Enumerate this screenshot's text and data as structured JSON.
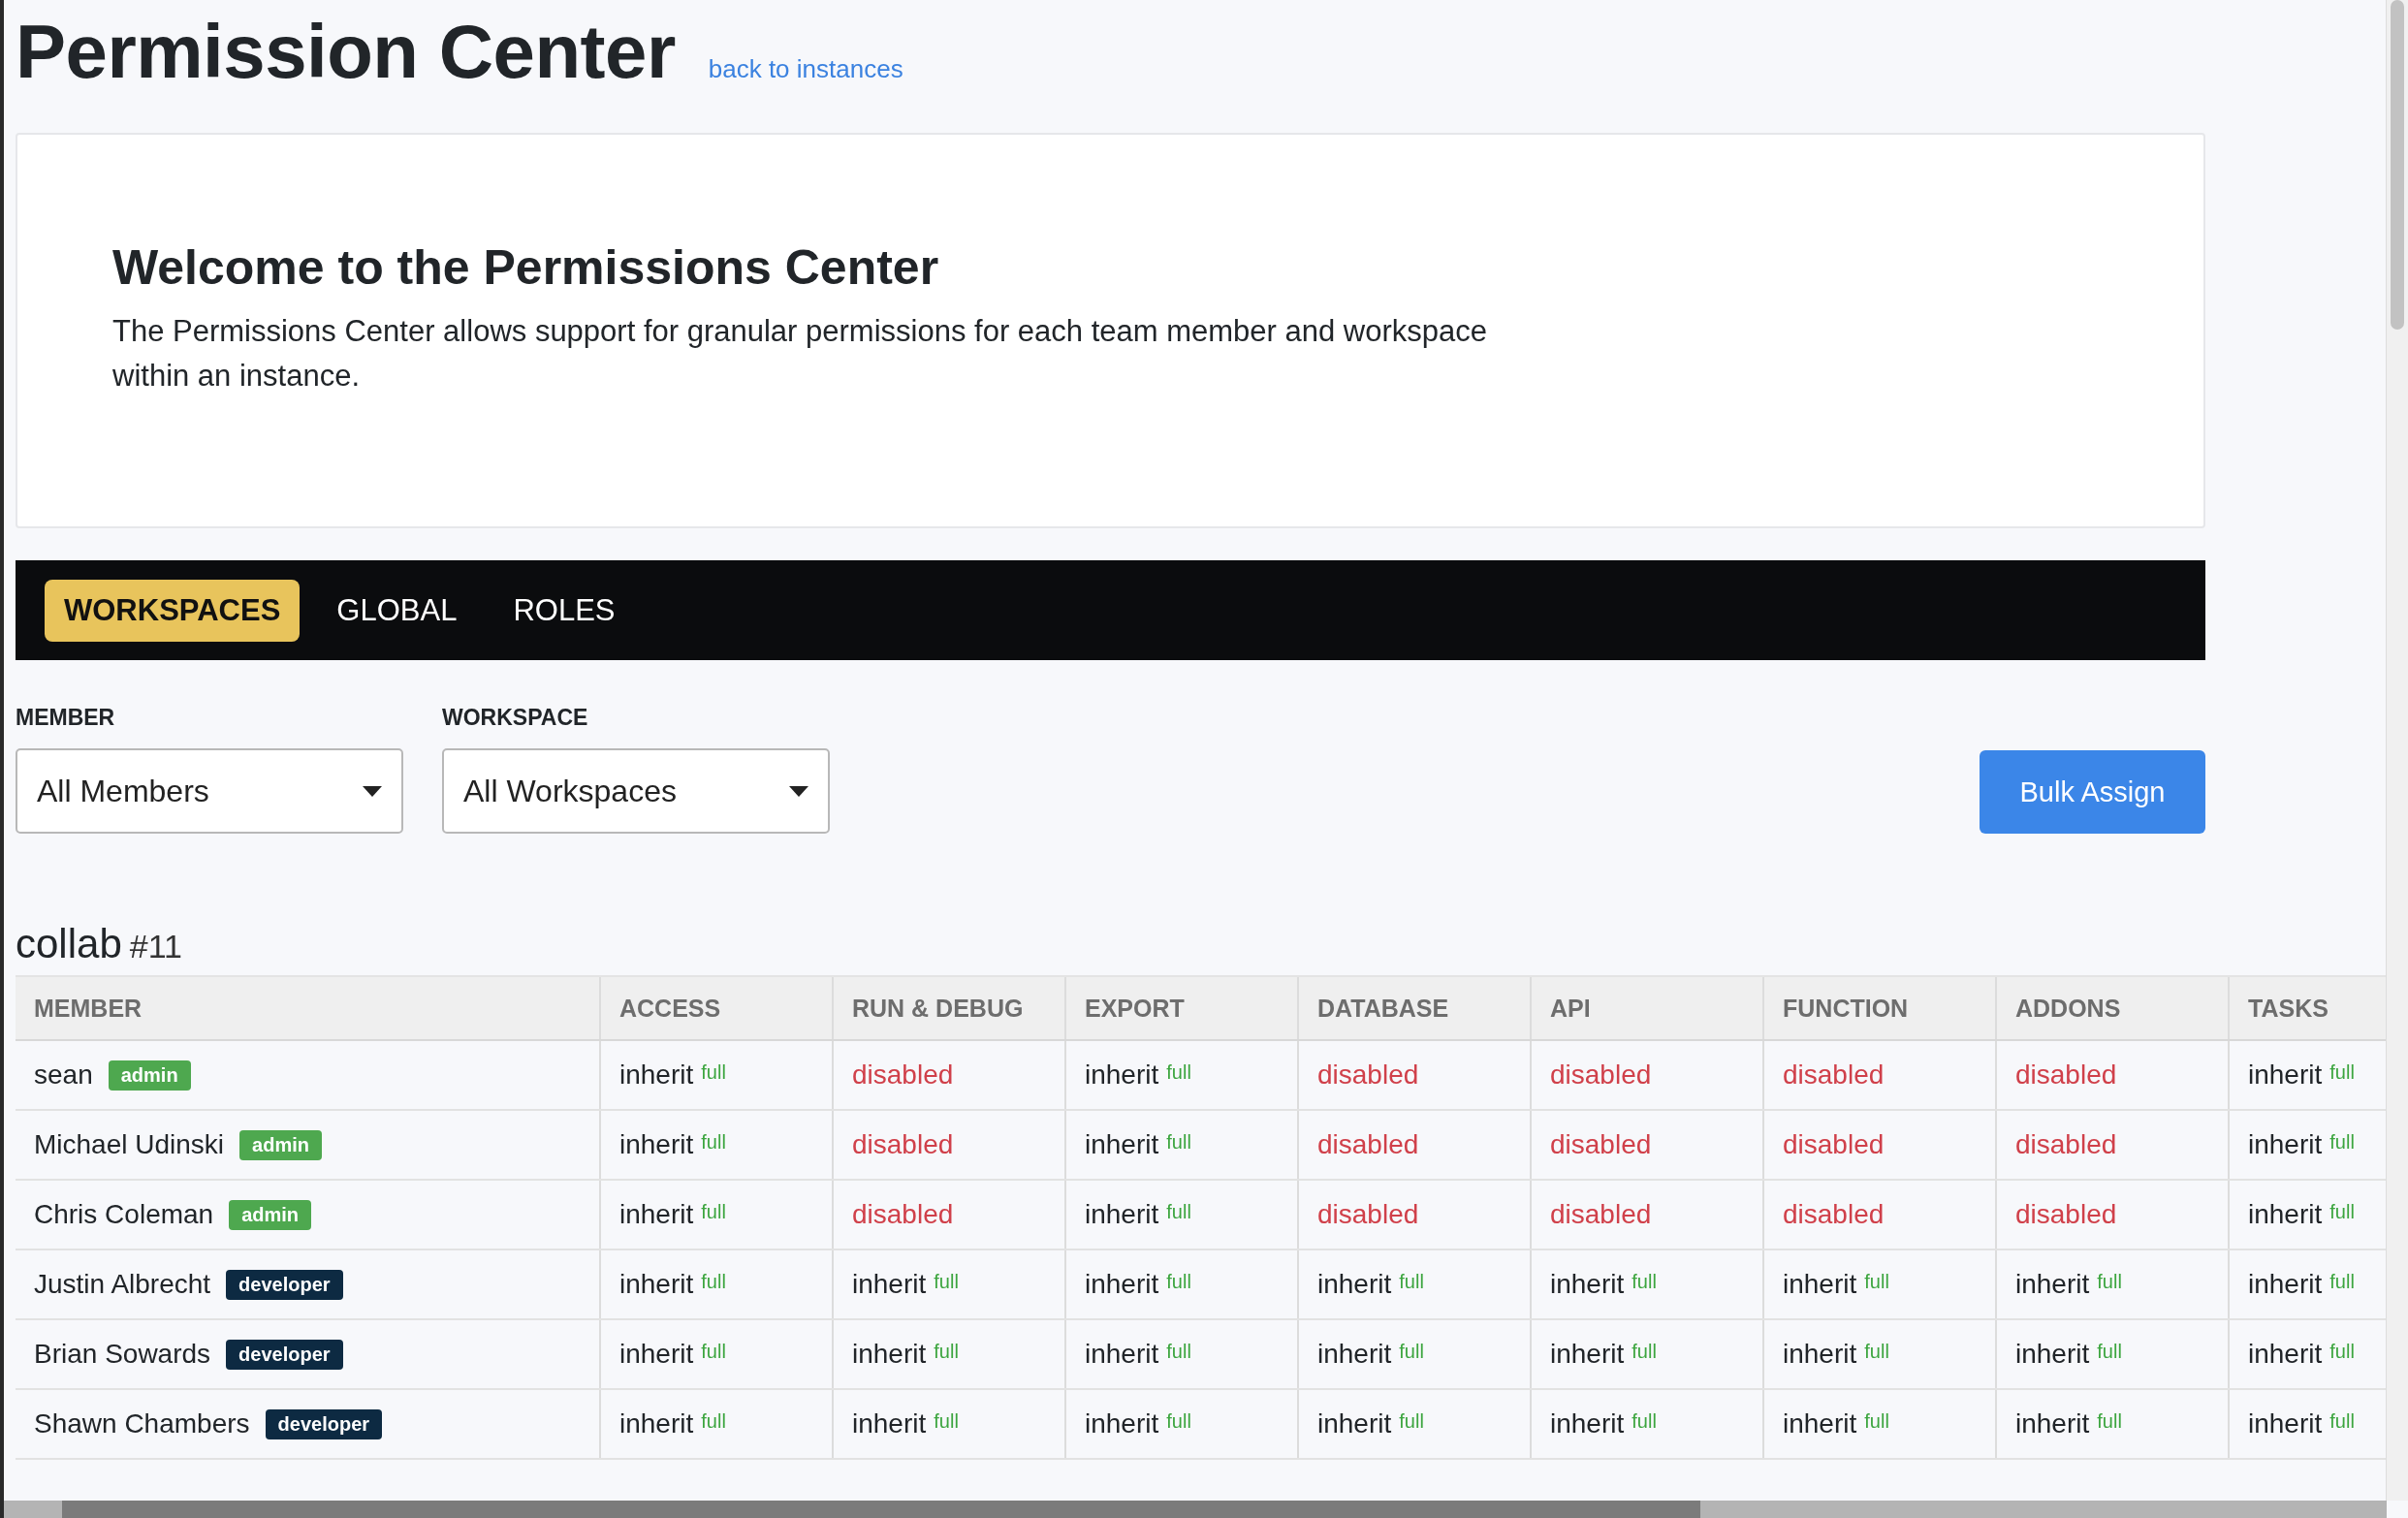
{
  "header": {
    "title": "Permission Center",
    "link": "back to instances"
  },
  "welcome": {
    "title": "Welcome to the Permissions Center",
    "text": "The Permissions Center allows support for granular permissions for each team member and workspace within an instance."
  },
  "tabs": [
    {
      "label": "WORKSPACES",
      "selected": true
    },
    {
      "label": "GLOBAL",
      "selected": false
    },
    {
      "label": "ROLES",
      "selected": false
    }
  ],
  "filters": [
    {
      "label": "MEMBER",
      "value": "All Members"
    },
    {
      "label": "WORKSPACE",
      "value": "All Workspaces"
    }
  ],
  "bulk_button": "Bulk Assign",
  "workspace": {
    "name": "collab",
    "number": "#11"
  },
  "table": {
    "columns": [
      "MEMBER",
      "ACCESS",
      "RUN & DEBUG",
      "EXPORT",
      "DATABASE",
      "API",
      "FUNCTION",
      "ADDONS",
      "TASKS"
    ],
    "rows": [
      {
        "cells": [
          {
            "kind": "member",
            "text": "sean",
            "role": "admin",
            "color": "#4ea84f"
          },
          {
            "kind": "inherit",
            "text": "inherit",
            "note": "full"
          },
          {
            "kind": "disabled",
            "text": "disabled"
          },
          {
            "kind": "inherit",
            "text": "inherit",
            "note": "full"
          },
          {
            "kind": "disabled",
            "text": "disabled"
          },
          {
            "kind": "disabled",
            "text": "disabled"
          },
          {
            "kind": "disabled",
            "text": "disabled"
          },
          {
            "kind": "disabled",
            "text": "disabled"
          },
          {
            "kind": "inherit",
            "text": "inherit",
            "note": "full"
          }
        ]
      },
      {
        "cells": [
          {
            "kind": "member",
            "text": "Michael Udinski",
            "role": "admin",
            "color": "#4ea84f"
          },
          {
            "kind": "inherit",
            "text": "inherit",
            "note": "full"
          },
          {
            "kind": "disabled",
            "text": "disabled"
          },
          {
            "kind": "inherit",
            "text": "inherit",
            "note": "full"
          },
          {
            "kind": "disabled",
            "text": "disabled"
          },
          {
            "kind": "disabled",
            "text": "disabled"
          },
          {
            "kind": "disabled",
            "text": "disabled"
          },
          {
            "kind": "disabled",
            "text": "disabled"
          },
          {
            "kind": "inherit",
            "text": "inherit",
            "note": "full"
          }
        ]
      },
      {
        "cells": [
          {
            "kind": "member",
            "text": "Chris Coleman",
            "role": "admin",
            "color": "#4ea84f"
          },
          {
            "kind": "inherit",
            "text": "inherit",
            "note": "full"
          },
          {
            "kind": "disabled",
            "text": "disabled"
          },
          {
            "kind": "inherit",
            "text": "inherit",
            "note": "full"
          },
          {
            "kind": "disabled",
            "text": "disabled"
          },
          {
            "kind": "disabled",
            "text": "disabled"
          },
          {
            "kind": "disabled",
            "text": "disabled"
          },
          {
            "kind": "disabled",
            "text": "disabled"
          },
          {
            "kind": "inherit",
            "text": "inherit",
            "note": "full"
          }
        ]
      },
      {
        "cells": [
          {
            "kind": "member",
            "text": "Justin Albrecht",
            "role": "developer",
            "color": "#0d2a42"
          },
          {
            "kind": "inherit",
            "text": "inherit",
            "note": "full"
          },
          {
            "kind": "inherit",
            "text": "inherit",
            "note": "full"
          },
          {
            "kind": "inherit",
            "text": "inherit",
            "note": "full"
          },
          {
            "kind": "inherit",
            "text": "inherit",
            "note": "full"
          },
          {
            "kind": "inherit",
            "text": "inherit",
            "note": "full"
          },
          {
            "kind": "inherit",
            "text": "inherit",
            "note": "full"
          },
          {
            "kind": "inherit",
            "text": "inherit",
            "note": "full"
          },
          {
            "kind": "inherit",
            "text": "inherit",
            "note": "full"
          }
        ]
      },
      {
        "cells": [
          {
            "kind": "member",
            "text": "Brian Sowards",
            "role": "developer",
            "color": "#0d2a42"
          },
          {
            "kind": "inherit",
            "text": "inherit",
            "note": "full"
          },
          {
            "kind": "inherit",
            "text": "inherit",
            "note": "full"
          },
          {
            "kind": "inherit",
            "text": "inherit",
            "note": "full"
          },
          {
            "kind": "inherit",
            "text": "inherit",
            "note": "full"
          },
          {
            "kind": "inherit",
            "text": "inherit",
            "note": "full"
          },
          {
            "kind": "inherit",
            "text": "inherit",
            "note": "full"
          },
          {
            "kind": "inherit",
            "text": "inherit",
            "note": "full"
          },
          {
            "kind": "inherit",
            "text": "inherit",
            "note": "full"
          }
        ]
      },
      {
        "cells": [
          {
            "kind": "member",
            "text": "Shawn Chambers",
            "role": "developer",
            "color": "#0d2a42"
          },
          {
            "kind": "inherit",
            "text": "inherit",
            "note": "full"
          },
          {
            "kind": "inherit",
            "text": "inherit",
            "note": "full"
          },
          {
            "kind": "inherit",
            "text": "inherit",
            "note": "full"
          },
          {
            "kind": "inherit",
            "text": "inherit",
            "note": "full"
          },
          {
            "kind": "inherit",
            "text": "inherit",
            "note": "full"
          },
          {
            "kind": "inherit",
            "text": "inherit",
            "note": "full"
          },
          {
            "kind": "inherit",
            "text": "inherit",
            "note": "full"
          },
          {
            "kind": "inherit",
            "text": "inherit",
            "note": "full"
          }
        ]
      }
    ]
  }
}
